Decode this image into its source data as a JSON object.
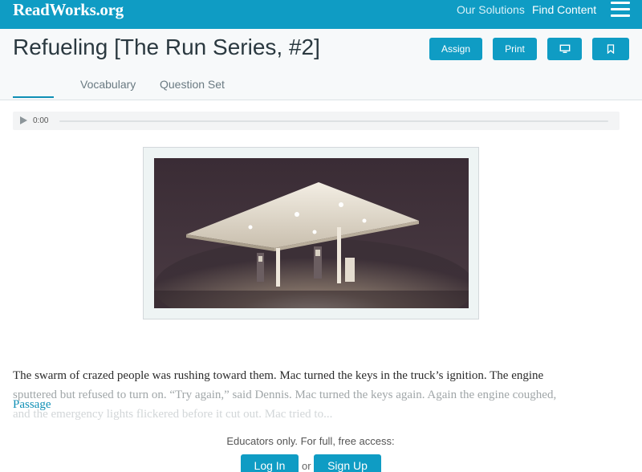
{
  "nav": {
    "logo": "ReadWorks.org",
    "links": [
      "Our Solutions",
      "Find Content"
    ],
    "menu_icon": "hamburger-icon"
  },
  "header": {
    "title": "Refueling [The Run Series, #2]",
    "buttons": {
      "assign": "Assign",
      "print": "Print",
      "present_icon": "monitor-icon",
      "bookmark_icon": "bookmark-icon"
    },
    "tabs": [
      "Passage",
      "Vocabulary",
      "Question Set"
    ],
    "active_tab": "Passage"
  },
  "audio": {
    "time": "0:00",
    "progress": 0
  },
  "passage": {
    "lines": [
      "The swarm of crazed people was rushing toward them. Mac turned the keys in the truck’s ignition. The engine",
      "sputtered but refused to turn on. “Try again,” said Dennis. Mac turned the keys again. Again the engine coughed,",
      "and the emergency lights flickered before it cut out. Mac tried to..."
    ]
  },
  "access": {
    "message": "Educators only. For full, free access:",
    "login": "Log In",
    "or": "or",
    "signup": "Sign Up"
  },
  "colors": {
    "brand": "#0f9cc4",
    "active_tab": "#0f8fb5",
    "title": "#2b3940"
  }
}
